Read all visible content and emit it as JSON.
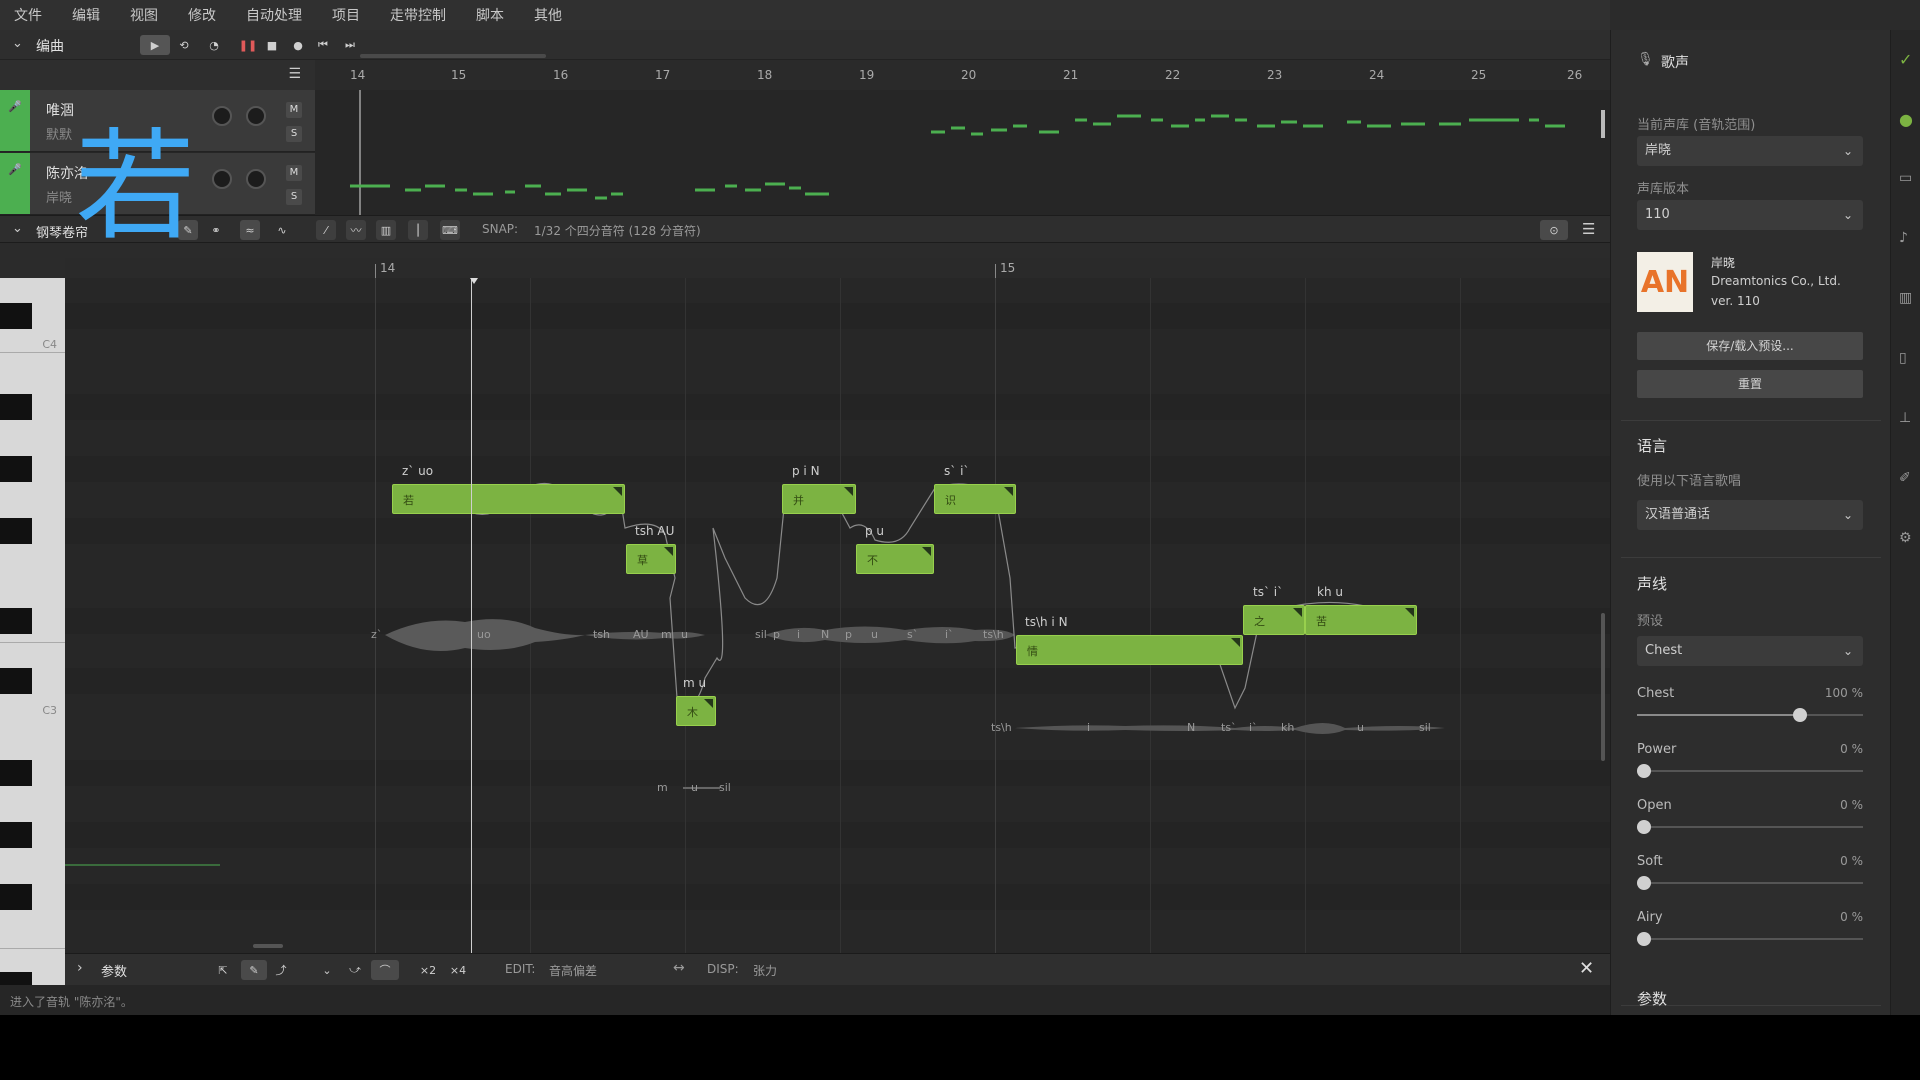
{
  "menu": [
    "文件",
    "编辑",
    "视图",
    "修改",
    "自动处理",
    "项目",
    "走带控制",
    "脚本",
    "其他"
  ],
  "arrangement": {
    "title": "编曲",
    "ruler": [
      "14",
      "15",
      "16",
      "17",
      "18",
      "19",
      "20",
      "21",
      "22",
      "23",
      "24",
      "25",
      "26"
    ],
    "tracks": [
      {
        "name": "唯涸",
        "sub": "默默"
      },
      {
        "name": "陈亦洺",
        "sub": "岸晓"
      }
    ],
    "m_label": "M",
    "s_label": "S"
  },
  "overlay_char": "若",
  "pianoroll": {
    "title": "钢琴卷帘",
    "snap_label": "SNAP:",
    "snap_value": "1/32 个四分音符 (128 分音符)",
    "ruler": [
      "14",
      "15"
    ],
    "key_labels": [
      "C4",
      "C3"
    ],
    "notes": [
      {
        "lyric": "若",
        "phoneme": "z` uo"
      },
      {
        "lyric": "草",
        "phoneme": "tsh AU"
      },
      {
        "lyric": "木",
        "phoneme": "m u"
      },
      {
        "lyric": "并",
        "phoneme": "p i N"
      },
      {
        "lyric": "不",
        "phoneme": "p u"
      },
      {
        "lyric": "识",
        "phoneme": "s` i`"
      },
      {
        "lyric": "情",
        "phoneme": "ts\\h i N"
      },
      {
        "lyric": "之",
        "phoneme": "ts` i`"
      },
      {
        "lyric": "苦",
        "phoneme": "kh u"
      }
    ],
    "wave_phonemes_1": [
      "z`",
      "uo",
      "tsh",
      "AU",
      "m",
      "u",
      "sil",
      "p",
      "i",
      "N",
      "p",
      "u",
      "s`",
      "i`",
      "ts\\h"
    ],
    "wave_phonemes_2": [
      "ts\\h",
      "i",
      "N",
      "ts`",
      "i`",
      "kh",
      "u",
      "sil"
    ],
    "wave_phonemes_3": [
      "m",
      "u",
      "sil"
    ]
  },
  "param_bar": {
    "title": "参数",
    "x2": "×2",
    "x4": "×4",
    "edit_label": "EDIT:",
    "edit_value": "音高偏差",
    "disp_label": "DISP:",
    "disp_value": "张力"
  },
  "status": "进入了音轨 \"陈亦洺\"。",
  "right_panel": {
    "title": "歌声",
    "voicebank_label": "当前声库 (音轨范围)",
    "voicebank_value": "岸晓",
    "version_label": "声库版本",
    "version_value": "110",
    "vb_name": "岸晓",
    "vb_company": "Dreamtonics Co., Ltd.",
    "vb_version": "ver. 110",
    "logo_text": "AN",
    "save_load": "保存/载入预设...",
    "reset": "重置",
    "language_header": "语言",
    "language_label": "使用以下语言歌唱",
    "language_value": "汉语普通话",
    "vocal_header": "声线",
    "preset_label": "预设",
    "preset_value": "Chest",
    "sliders": [
      {
        "name": "Chest",
        "value": "100 %",
        "level": 1.0
      },
      {
        "name": "Power",
        "value": "0 %",
        "level": 0
      },
      {
        "name": "Open",
        "value": "0 %",
        "level": 0
      },
      {
        "name": "Soft",
        "value": "0 %",
        "level": 0
      },
      {
        "name": "Airy",
        "value": "0 %",
        "level": 0
      }
    ],
    "params_header": "参数"
  },
  "colors": {
    "accent_green": "#7cb342",
    "track_green": "#4caf50",
    "overlay_blue": "#3fa9f5",
    "record_red": "#e05a5a"
  }
}
